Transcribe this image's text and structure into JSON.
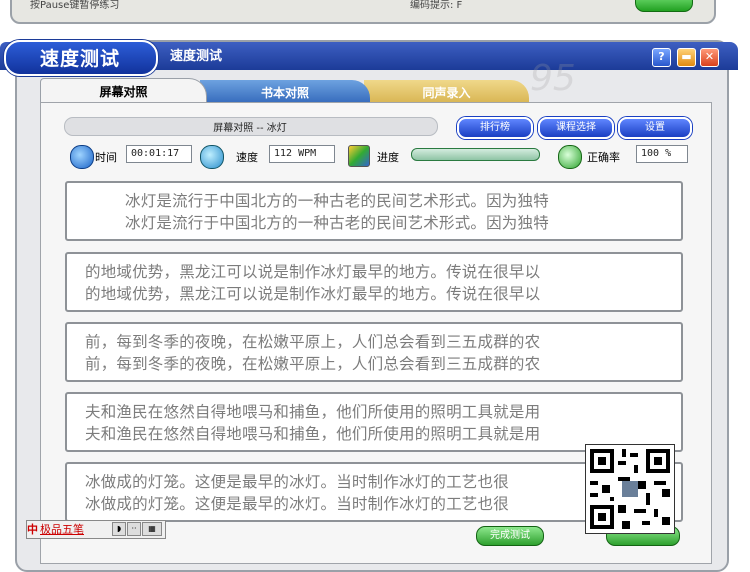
{
  "previous_window": {
    "hint_text": "按Pause键暂停练习",
    "tip_text": "编码提示: F"
  },
  "window": {
    "app_tab_label": "速度测试",
    "title": "速度测试",
    "buttons": {
      "help": "?",
      "minimize": "▬",
      "close": "✕"
    }
  },
  "tabs": [
    {
      "label": "屏幕对照",
      "active": true
    },
    {
      "label": "书本对照",
      "active": false
    },
    {
      "label": "同声录入",
      "active": false
    }
  ],
  "info": {
    "text": "屏幕对照 -- 冰灯",
    "rank_button": "排行榜",
    "course_button": "课程选择",
    "settings_button": "设置"
  },
  "stats": {
    "time_label": "时间",
    "time_value": "00:01:17",
    "speed_label": "速度",
    "speed_value": "112 WPM",
    "progress_label": "进度",
    "progress_fraction": 0.0,
    "accuracy_label": "正确率",
    "accuracy_value": "100 %"
  },
  "text_blocks": [
    {
      "original": "冰灯是流行于中国北方的一种古老的民间艺术形式。因为独特",
      "typed": "冰灯是流行于中国北方的一种古老的民间艺术形式。因为独特"
    },
    {
      "original": "的地域优势，黑龙江可以说是制作冰灯最早的地方。传说在很早以",
      "typed": "的地域优势，黑龙江可以说是制作冰灯最早的地方。传说在很早以"
    },
    {
      "original": "前，每到冬季的夜晚，在松嫩平原上，人们总会看到三五成群的农",
      "typed": "前，每到冬季的夜晚，在松嫩平原上，人们总会看到三五成群的农"
    },
    {
      "original": "夫和渔民在悠然自得地喂马和捕鱼，他们所使用的照明工具就是用",
      "typed": "夫和渔民在悠然自得地喂马和捕鱼，他们所使用的照明工具就是用"
    },
    {
      "original": "冰做成的灯笼。这便是最早的冰灯。当时制作冰灯的工艺也很",
      "typed": "冰做成的灯笼。这便是最早的冰灯。当时制作冰灯的工艺也很"
    }
  ],
  "ime": {
    "label": "极品五笔",
    "logo": "中"
  },
  "bottom": {
    "finish_button": "完成测试"
  }
}
